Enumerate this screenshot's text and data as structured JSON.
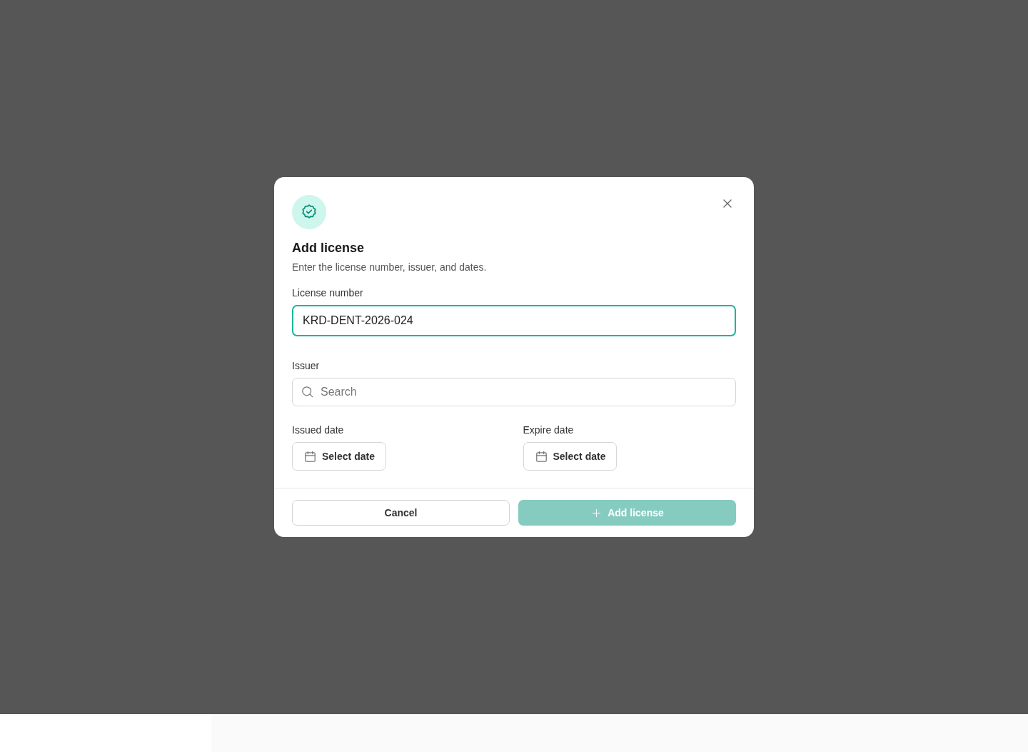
{
  "dialog": {
    "title": "Add license",
    "description": "Enter the license number, issuer, and dates.",
    "license_number": {
      "label": "License number",
      "value": "KRD-DENT-2026-024",
      "focused": true
    },
    "issuer": {
      "label": "Issuer",
      "placeholder": "Search"
    },
    "dates": [
      {
        "label": "Issued date",
        "button": "Select date"
      },
      {
        "label": "Expire date",
        "button": "Select date"
      }
    ],
    "cancel": {
      "label": "Cancel"
    },
    "submit": {
      "label": "Add license",
      "disabled": true
    }
  }
}
